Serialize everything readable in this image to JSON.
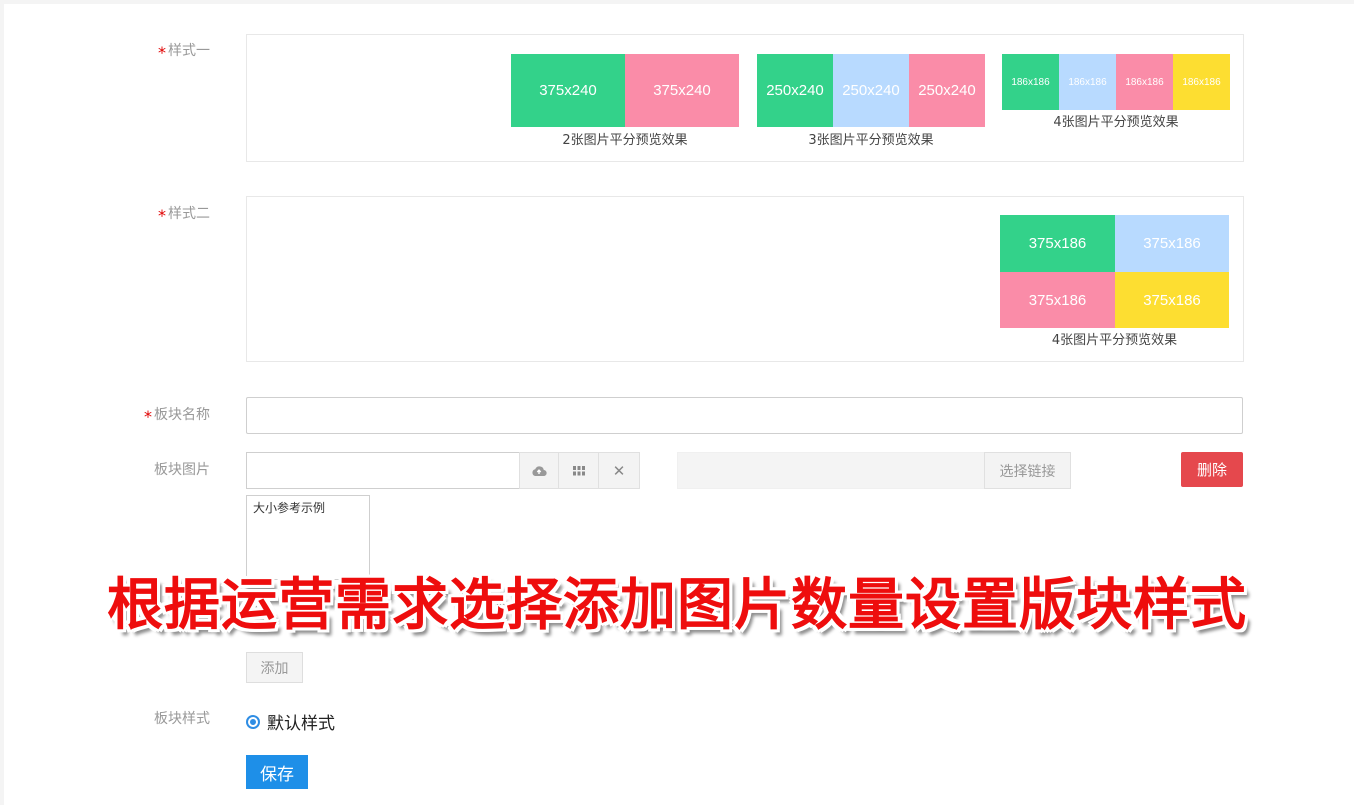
{
  "style1": {
    "label": "样式一",
    "groups": [
      {
        "tiles": [
          "375x240",
          "375x240"
        ],
        "caption": "2张图片平分预览效果"
      },
      {
        "tiles": [
          "250x240",
          "250x240",
          "250x240"
        ],
        "caption": "3张图片平分预览效果"
      },
      {
        "tiles": [
          "186x186",
          "186x186",
          "186x186",
          "186x186"
        ],
        "caption": "4张图片平分预览效果"
      }
    ]
  },
  "style2": {
    "label": "样式二",
    "tiles": [
      "375x186",
      "375x186",
      "375x186",
      "375x186"
    ],
    "caption": "4张图片平分预览效果"
  },
  "block_name": {
    "label": "板块名称",
    "value": ""
  },
  "block_image": {
    "label": "板块图片",
    "image_value": "",
    "link_value": "",
    "select_link_label": "选择链接",
    "delete_label": "删除",
    "thumb_text": "大小参考示例",
    "icons": [
      "upload-cloud-icon",
      "grid-icon",
      "close-icon"
    ]
  },
  "add_label": "添加",
  "block_style": {
    "label": "板块样式",
    "option": "默认样式",
    "selected": true
  },
  "save_label": "保存",
  "banner": "根据运营需求选择添加图片数量设置版块样式",
  "colors": {
    "green": "#33d28a",
    "pink": "#fa8ca8",
    "blue": "#b8daff",
    "yellow": "#fdde31",
    "primary": "#1e8fe8",
    "danger": "#e5484d"
  }
}
